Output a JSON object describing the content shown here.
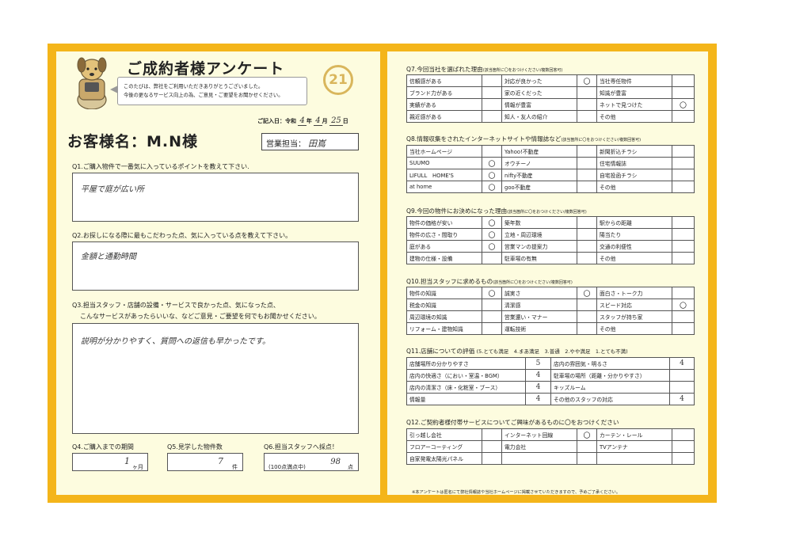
{
  "header": {
    "title": "ご成約者様アンケート",
    "greeting_line1": "このたびは、弊社をご利用いただきありがとうございました。",
    "greeting_line2": "今後の更なるサービス向上の為、ご意見・ご要望をお聞かせください。",
    "logo_text": "21",
    "date_prefix": "ご記入日：令和",
    "date_year": "4",
    "date_year_label": "年",
    "date_month": "4",
    "date_month_label": "月",
    "date_day": "25",
    "date_day_label": "日"
  },
  "customer": {
    "label": "お客様名：",
    "name": "M.N様"
  },
  "staff": {
    "label": "営業担当：",
    "name": "田嶌"
  },
  "q1": {
    "question": "Q1.ご購入物件で一番気に入っているポイントを教えて下さい.",
    "answer": "平屋で庭が広い所"
  },
  "q2": {
    "question": "Q2.お探しになる際に最もこだわった点、気に入っている点を教えて下さい。",
    "answer": "金額と通勤時間"
  },
  "q3": {
    "question_line1": "Q3.担当スタッフ・店舗の設備・サービスで良かった点、気になった点、",
    "question_line2": "こんなサービスがあったらいいな、などご意見・ご要望を何でもお聞かせください。",
    "answer": "説明が分かりやすく、質問への返信も早かったです。"
  },
  "q4": {
    "question": "Q4.ご購入までの期間",
    "value": "1",
    "unit": "ヶ月"
  },
  "q5": {
    "question": "Q5.見学した物件数",
    "value": "7",
    "unit": "件"
  },
  "q6": {
    "question": "Q6.担当スタッフへ採点！",
    "note": "(100点満点中)",
    "value": "98",
    "unit": "点"
  },
  "q7": {
    "title": "Q7.今回当社を選ばれた理由",
    "note": "(該当箇所に〇をおつけください/複数回答可)",
    "rows": [
      [
        "信頼感がある",
        "",
        "対応が良かった",
        "〇",
        "当社専任物件",
        ""
      ],
      [
        "ブランド力がある",
        "",
        "家の近くだった",
        "",
        "知識が豊富",
        ""
      ],
      [
        "実績がある",
        "",
        "情報が豊富",
        "",
        "ネットで見つけた",
        "〇"
      ],
      [
        "親近感がある",
        "",
        "知人・友人の紹介",
        "",
        "その他",
        ""
      ]
    ]
  },
  "q8": {
    "title": "Q8.情報収集をされたインターネットサイトや情報誌など",
    "note": "(該当箇所に〇をおつけください/複数回答可)",
    "rows": [
      [
        "当社ホームページ",
        "",
        "Yahoo!不動産",
        "",
        "新聞折込チラシ",
        ""
      ],
      [
        "SUUMO",
        "〇",
        "オウチーノ",
        "",
        "住宅情報誌",
        ""
      ],
      [
        "LIFULL　HOME'S",
        "〇",
        "nifty不動産",
        "",
        "自宅投函チラシ",
        ""
      ],
      [
        "at home",
        "〇",
        "goo不動産",
        "",
        "その他",
        ""
      ]
    ]
  },
  "q9": {
    "title": "Q9.今回の物件にお決めになった理由",
    "note": "(該当箇所に〇をおつけください/複数回答可)",
    "rows": [
      [
        "物件の価格が安い",
        "〇",
        "築年数",
        "",
        "駅からの距離",
        ""
      ],
      [
        "物件の広さ・間取り",
        "〇",
        "立地・周辺環境",
        "",
        "陽当たり",
        ""
      ],
      [
        "庭がある",
        "〇",
        "営業マンの提案力",
        "",
        "交通の利便性",
        ""
      ],
      [
        "建物の仕様・設備",
        "",
        "駐車場の有無",
        "",
        "その他",
        ""
      ]
    ]
  },
  "q10": {
    "title": "Q10.担当スタッフに求めるもの",
    "note": "(該当箇所に〇をおつけください/複数回答可)",
    "rows": [
      [
        "物件の知識",
        "〇",
        "誠実さ",
        "〇",
        "面白さ・トーク力",
        ""
      ],
      [
        "税金の知識",
        "",
        "清潔感",
        "",
        "スピード対応",
        "〇"
      ],
      [
        "周辺環境の知識",
        "",
        "営業還い・マナー",
        "",
        "スタッフが持ち家",
        ""
      ],
      [
        "リフォーム・建物知識",
        "",
        "運転技術",
        "",
        "その他",
        ""
      ]
    ]
  },
  "q11": {
    "title": "Q11.店舗についての評価",
    "scale": "(5.とても満足　4.まあ満足　3.普通　2.やや満足　1.とても不満)",
    "rows": [
      [
        "店舗場所の分かりやすさ",
        "5",
        "店内の雰囲気・明るさ",
        "4"
      ],
      [
        "店内の快適さ（におい・室温・BGM）",
        "4",
        "駐車場の場所（距離・分かりやすさ）",
        ""
      ],
      [
        "店内の清潔さ（床・化粧室・ブース）",
        "4",
        "キッズルーム",
        ""
      ],
      [
        "情報量",
        "4",
        "その他のスタッフの対応",
        "4"
      ]
    ]
  },
  "q12": {
    "title": "Q12.ご契約者様付帯サービスについてご興味があるものに〇をおつけください",
    "rows": [
      [
        "引っ越し会社",
        "",
        "インターネット回線",
        "〇",
        "カーテン・レール",
        ""
      ],
      [
        "フロアーコーティング",
        "",
        "電力会社",
        "",
        "TVアンテナ",
        ""
      ],
      [
        "自家発電太陽光パネル",
        "",
        "",
        "",
        "",
        ""
      ]
    ]
  },
  "footer": "※本アンケートは匿名にて弊社情報誌や当社ホームページに掲載させていただきますので、予めご了承ください。",
  "colors": {
    "frame": "#f4b51a",
    "panel": "#fdfcdf"
  }
}
